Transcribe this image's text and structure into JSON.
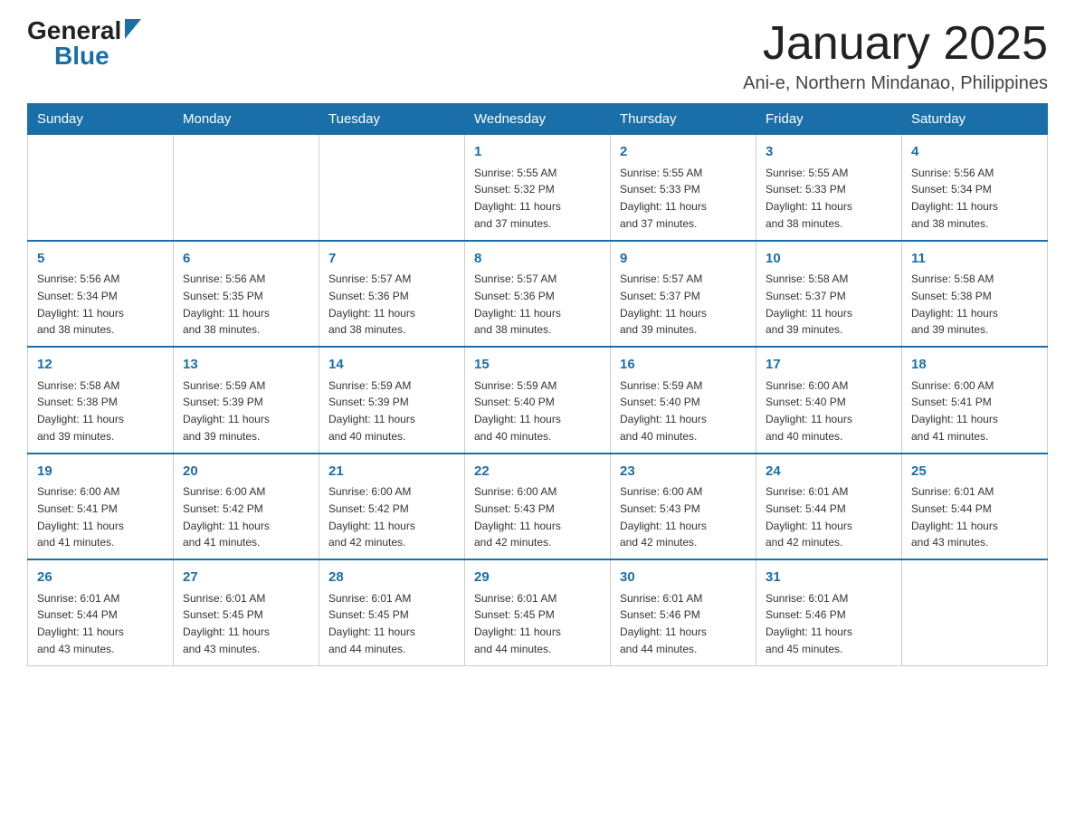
{
  "header": {
    "logo_general": "General",
    "logo_blue": "Blue",
    "main_title": "January 2025",
    "subtitle": "Ani-e, Northern Mindanao, Philippines"
  },
  "days_of_week": [
    "Sunday",
    "Monday",
    "Tuesday",
    "Wednesday",
    "Thursday",
    "Friday",
    "Saturday"
  ],
  "weeks": [
    [
      {
        "day": "",
        "info": ""
      },
      {
        "day": "",
        "info": ""
      },
      {
        "day": "",
        "info": ""
      },
      {
        "day": "1",
        "info": "Sunrise: 5:55 AM\nSunset: 5:32 PM\nDaylight: 11 hours\nand 37 minutes."
      },
      {
        "day": "2",
        "info": "Sunrise: 5:55 AM\nSunset: 5:33 PM\nDaylight: 11 hours\nand 37 minutes."
      },
      {
        "day": "3",
        "info": "Sunrise: 5:55 AM\nSunset: 5:33 PM\nDaylight: 11 hours\nand 38 minutes."
      },
      {
        "day": "4",
        "info": "Sunrise: 5:56 AM\nSunset: 5:34 PM\nDaylight: 11 hours\nand 38 minutes."
      }
    ],
    [
      {
        "day": "5",
        "info": "Sunrise: 5:56 AM\nSunset: 5:34 PM\nDaylight: 11 hours\nand 38 minutes."
      },
      {
        "day": "6",
        "info": "Sunrise: 5:56 AM\nSunset: 5:35 PM\nDaylight: 11 hours\nand 38 minutes."
      },
      {
        "day": "7",
        "info": "Sunrise: 5:57 AM\nSunset: 5:36 PM\nDaylight: 11 hours\nand 38 minutes."
      },
      {
        "day": "8",
        "info": "Sunrise: 5:57 AM\nSunset: 5:36 PM\nDaylight: 11 hours\nand 38 minutes."
      },
      {
        "day": "9",
        "info": "Sunrise: 5:57 AM\nSunset: 5:37 PM\nDaylight: 11 hours\nand 39 minutes."
      },
      {
        "day": "10",
        "info": "Sunrise: 5:58 AM\nSunset: 5:37 PM\nDaylight: 11 hours\nand 39 minutes."
      },
      {
        "day": "11",
        "info": "Sunrise: 5:58 AM\nSunset: 5:38 PM\nDaylight: 11 hours\nand 39 minutes."
      }
    ],
    [
      {
        "day": "12",
        "info": "Sunrise: 5:58 AM\nSunset: 5:38 PM\nDaylight: 11 hours\nand 39 minutes."
      },
      {
        "day": "13",
        "info": "Sunrise: 5:59 AM\nSunset: 5:39 PM\nDaylight: 11 hours\nand 39 minutes."
      },
      {
        "day": "14",
        "info": "Sunrise: 5:59 AM\nSunset: 5:39 PM\nDaylight: 11 hours\nand 40 minutes."
      },
      {
        "day": "15",
        "info": "Sunrise: 5:59 AM\nSunset: 5:40 PM\nDaylight: 11 hours\nand 40 minutes."
      },
      {
        "day": "16",
        "info": "Sunrise: 5:59 AM\nSunset: 5:40 PM\nDaylight: 11 hours\nand 40 minutes."
      },
      {
        "day": "17",
        "info": "Sunrise: 6:00 AM\nSunset: 5:40 PM\nDaylight: 11 hours\nand 40 minutes."
      },
      {
        "day": "18",
        "info": "Sunrise: 6:00 AM\nSunset: 5:41 PM\nDaylight: 11 hours\nand 41 minutes."
      }
    ],
    [
      {
        "day": "19",
        "info": "Sunrise: 6:00 AM\nSunset: 5:41 PM\nDaylight: 11 hours\nand 41 minutes."
      },
      {
        "day": "20",
        "info": "Sunrise: 6:00 AM\nSunset: 5:42 PM\nDaylight: 11 hours\nand 41 minutes."
      },
      {
        "day": "21",
        "info": "Sunrise: 6:00 AM\nSunset: 5:42 PM\nDaylight: 11 hours\nand 42 minutes."
      },
      {
        "day": "22",
        "info": "Sunrise: 6:00 AM\nSunset: 5:43 PM\nDaylight: 11 hours\nand 42 minutes."
      },
      {
        "day": "23",
        "info": "Sunrise: 6:00 AM\nSunset: 5:43 PM\nDaylight: 11 hours\nand 42 minutes."
      },
      {
        "day": "24",
        "info": "Sunrise: 6:01 AM\nSunset: 5:44 PM\nDaylight: 11 hours\nand 42 minutes."
      },
      {
        "day": "25",
        "info": "Sunrise: 6:01 AM\nSunset: 5:44 PM\nDaylight: 11 hours\nand 43 minutes."
      }
    ],
    [
      {
        "day": "26",
        "info": "Sunrise: 6:01 AM\nSunset: 5:44 PM\nDaylight: 11 hours\nand 43 minutes."
      },
      {
        "day": "27",
        "info": "Sunrise: 6:01 AM\nSunset: 5:45 PM\nDaylight: 11 hours\nand 43 minutes."
      },
      {
        "day": "28",
        "info": "Sunrise: 6:01 AM\nSunset: 5:45 PM\nDaylight: 11 hours\nand 44 minutes."
      },
      {
        "day": "29",
        "info": "Sunrise: 6:01 AM\nSunset: 5:45 PM\nDaylight: 11 hours\nand 44 minutes."
      },
      {
        "day": "30",
        "info": "Sunrise: 6:01 AM\nSunset: 5:46 PM\nDaylight: 11 hours\nand 44 minutes."
      },
      {
        "day": "31",
        "info": "Sunrise: 6:01 AM\nSunset: 5:46 PM\nDaylight: 11 hours\nand 45 minutes."
      },
      {
        "day": "",
        "info": ""
      }
    ]
  ]
}
